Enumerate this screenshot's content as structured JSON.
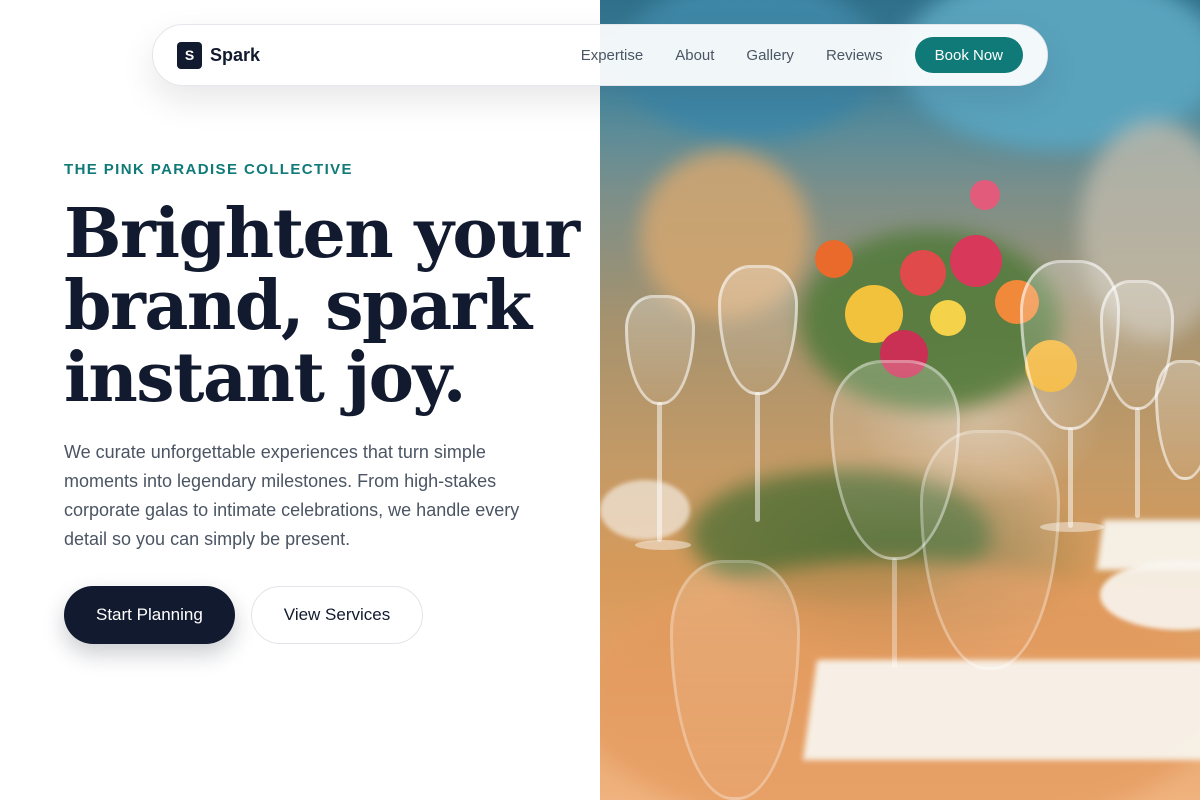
{
  "brand": {
    "mark": "S",
    "name": "Spark"
  },
  "nav": {
    "links": [
      {
        "label": "Expertise"
      },
      {
        "label": "About"
      },
      {
        "label": "Gallery"
      },
      {
        "label": "Reviews"
      }
    ],
    "cta_label": "Book Now"
  },
  "hero": {
    "eyebrow": "THE PINK PARADISE COLLECTIVE",
    "headline": "Brighten your brand, spark instant joy.",
    "lede": "We curate unforgettable experiences that turn simple moments into legendary milestones. From high-stakes corporate galas to intimate celebrations, we handle every detail so you can simply be present.",
    "primary_cta": "Start Planning",
    "secondary_cta": "View Services"
  },
  "colors": {
    "accent": "#0f7a78",
    "ink": "#111a2e",
    "muted": "#4b5563"
  },
  "image": {
    "subject": "event-table-floral-centerpiece"
  }
}
